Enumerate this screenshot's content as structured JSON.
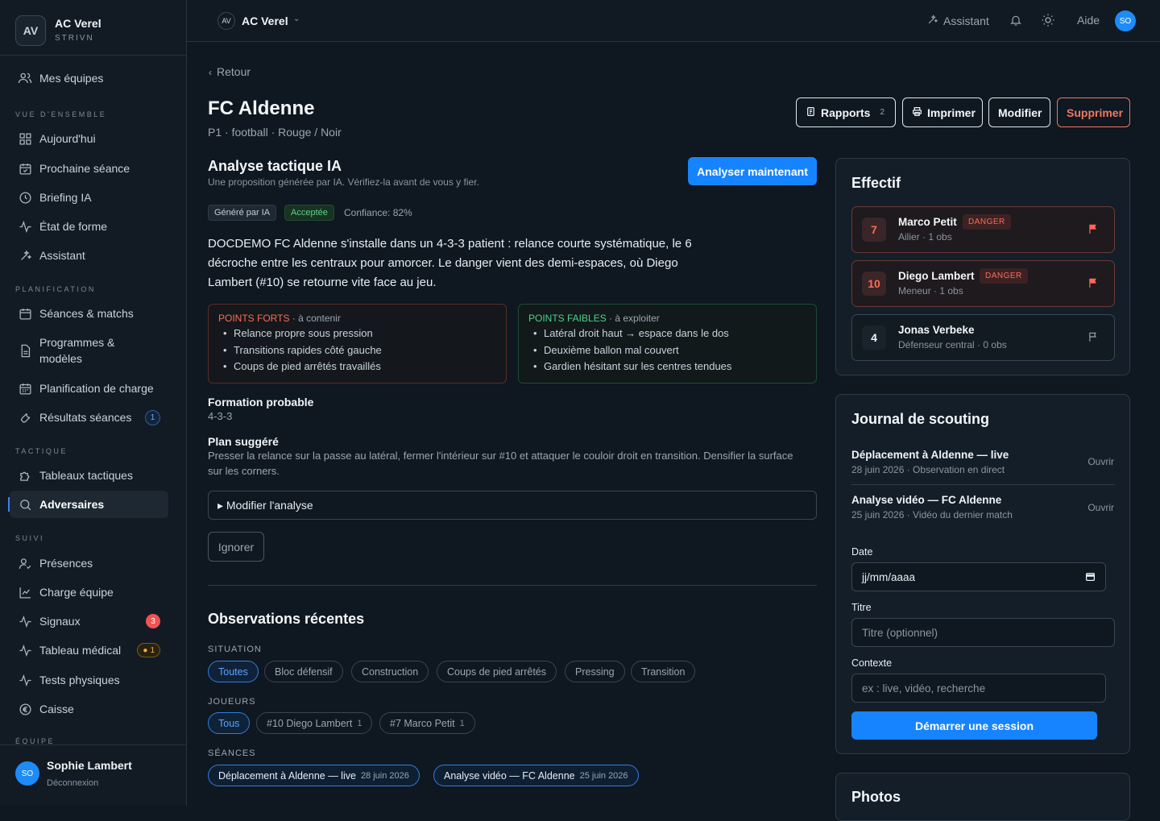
{
  "sidebar": {
    "brand": {
      "initials": "AV",
      "name": "AC Verel",
      "sub": "STRIVN"
    },
    "top_item": "Mes équipes",
    "sections": {
      "overview": "VUE D'ENSEMBLE",
      "planning": "PLANIFICATION",
      "tactics": "TACTIQUE",
      "followup": "SUIVI",
      "team": "ÉQUIPE"
    },
    "items": {
      "today": "Aujourd'hui",
      "next_session": "Prochaine séance",
      "briefing": "Briefing IA",
      "fitness": "État de forme",
      "assistant": "Assistant",
      "sessions": "Séances & matchs",
      "programs": "Programmes & modèles",
      "load_planning": "Planification de charge",
      "results": "Résultats séances",
      "boards": "Tableaux tactiques",
      "opponents": "Adversaires",
      "attendance": "Présences",
      "team_load": "Charge équipe",
      "signals": "Signaux",
      "medical": "Tableau médical",
      "tests": "Tests physiques",
      "cash": "Caisse"
    },
    "badges": {
      "results": "1",
      "signals": "3",
      "medical": "1"
    },
    "user": {
      "initials": "SO",
      "name": "Sophie Lambert",
      "logout": "Déconnexion"
    }
  },
  "topbar": {
    "club_initials": "AV",
    "club_name": "AC Verel",
    "assistant": "Assistant",
    "help": "Aide",
    "user_initials": "SO"
  },
  "page": {
    "back": "Retour",
    "title": "FC Aldenne",
    "subtitle": "P1 · football · Rouge / Noir",
    "actions": {
      "reports": "Rapports",
      "reports_count": "2",
      "print": "Imprimer",
      "edit": "Modifier",
      "delete": "Supprimer"
    }
  },
  "analysis": {
    "title": "Analyse tactique IA",
    "subtitle": "Une proposition générée par IA. Vérifiez-la avant de vous y fier.",
    "analyze_button": "Analyser maintenant",
    "tag_generated": "Généré par IA",
    "tag_accepted": "Acceptée",
    "confidence": "Confiance: 82%",
    "summary": "DOCDEMO FC Aldenne s'installe dans un 4-3-3 patient : relance courte systématique, le 6 décroche entre les centraux pour amorcer. Le danger vient des demi-espaces, où Diego Lambert (#10) se retourne vite face au jeu.",
    "strengths": {
      "title": "POINTS FORTS",
      "hint": "· à contenir",
      "items": [
        "Relance propre sous pression",
        "Transitions rapides côté gauche",
        "Coups de pied arrêtés travaillés"
      ]
    },
    "weaknesses": {
      "title": "POINTS FAIBLES",
      "hint": "· à exploiter",
      "items": [
        "Latéral droit haut → espace dans le dos",
        "Deuxième ballon mal couvert",
        "Gardien hésitant sur les centres tendues"
      ]
    },
    "formation_label": "Formation probable",
    "formation_value": "4-3-3",
    "plan_label": "Plan suggéré",
    "plan_value": "Presser la relance sur la passe au latéral, fermer l'intérieur sur #10 et attaquer le couloir droit en transition. Densifier la surface sur les corners.",
    "edit_details": "▸ Modifier l'analyse",
    "ignore": "Ignorer"
  },
  "observations": {
    "title": "Observations récentes",
    "situation_label": "SITUATION",
    "situations": [
      "Toutes",
      "Bloc défensif",
      "Construction",
      "Coups de pied arrêtés",
      "Pressing",
      "Transition"
    ],
    "players_label": "JOUEURS",
    "players": [
      {
        "label": "Tous",
        "count": ""
      },
      {
        "label": "#10 Diego Lambert",
        "count": "1"
      },
      {
        "label": "#7 Marco Petit",
        "count": "1"
      }
    ],
    "sessions_label": "SÉANCES",
    "sessions": [
      {
        "label": "Déplacement à Aldenne — live",
        "date": "28 juin 2026"
      },
      {
        "label": "Analyse vidéo — FC Aldenne",
        "date": "25 juin 2026"
      }
    ]
  },
  "roster": {
    "title": "Effectif",
    "players": [
      {
        "number": "7",
        "name": "Marco Petit",
        "tag": "DANGER",
        "sub": "Ailier · 1 obs"
      },
      {
        "number": "10",
        "name": "Diego Lambert",
        "tag": "DANGER",
        "sub": "Meneur · 1 obs"
      },
      {
        "number": "4",
        "name": "Jonas Verbeke",
        "tag": "",
        "sub": "Défenseur central · 0 obs"
      }
    ]
  },
  "scouting": {
    "title": "Journal de scouting",
    "entries": [
      {
        "title": "Déplacement à Aldenne — live",
        "sub": "28 juin 2026 · Observation en direct",
        "action": "Ouvrir"
      },
      {
        "title": "Analyse vidéo — FC Aldenne",
        "sub": "25 juin 2026 · Vidéo du dernier match",
        "action": "Ouvrir"
      }
    ],
    "date_label": "Date",
    "date_placeholder": "jj/mm/aaaa",
    "title_label": "Titre",
    "title_placeholder": "Titre (optionnel)",
    "context_label": "Contexte",
    "context_placeholder": "ex : live, vidéo, recherche",
    "start_button": "Démarrer une session"
  },
  "photos": {
    "title": "Photos"
  },
  "colors": {
    "accent": "#1784ff",
    "danger": "#ff6a55",
    "success": "#4cd38a",
    "background": "#0f1720"
  }
}
